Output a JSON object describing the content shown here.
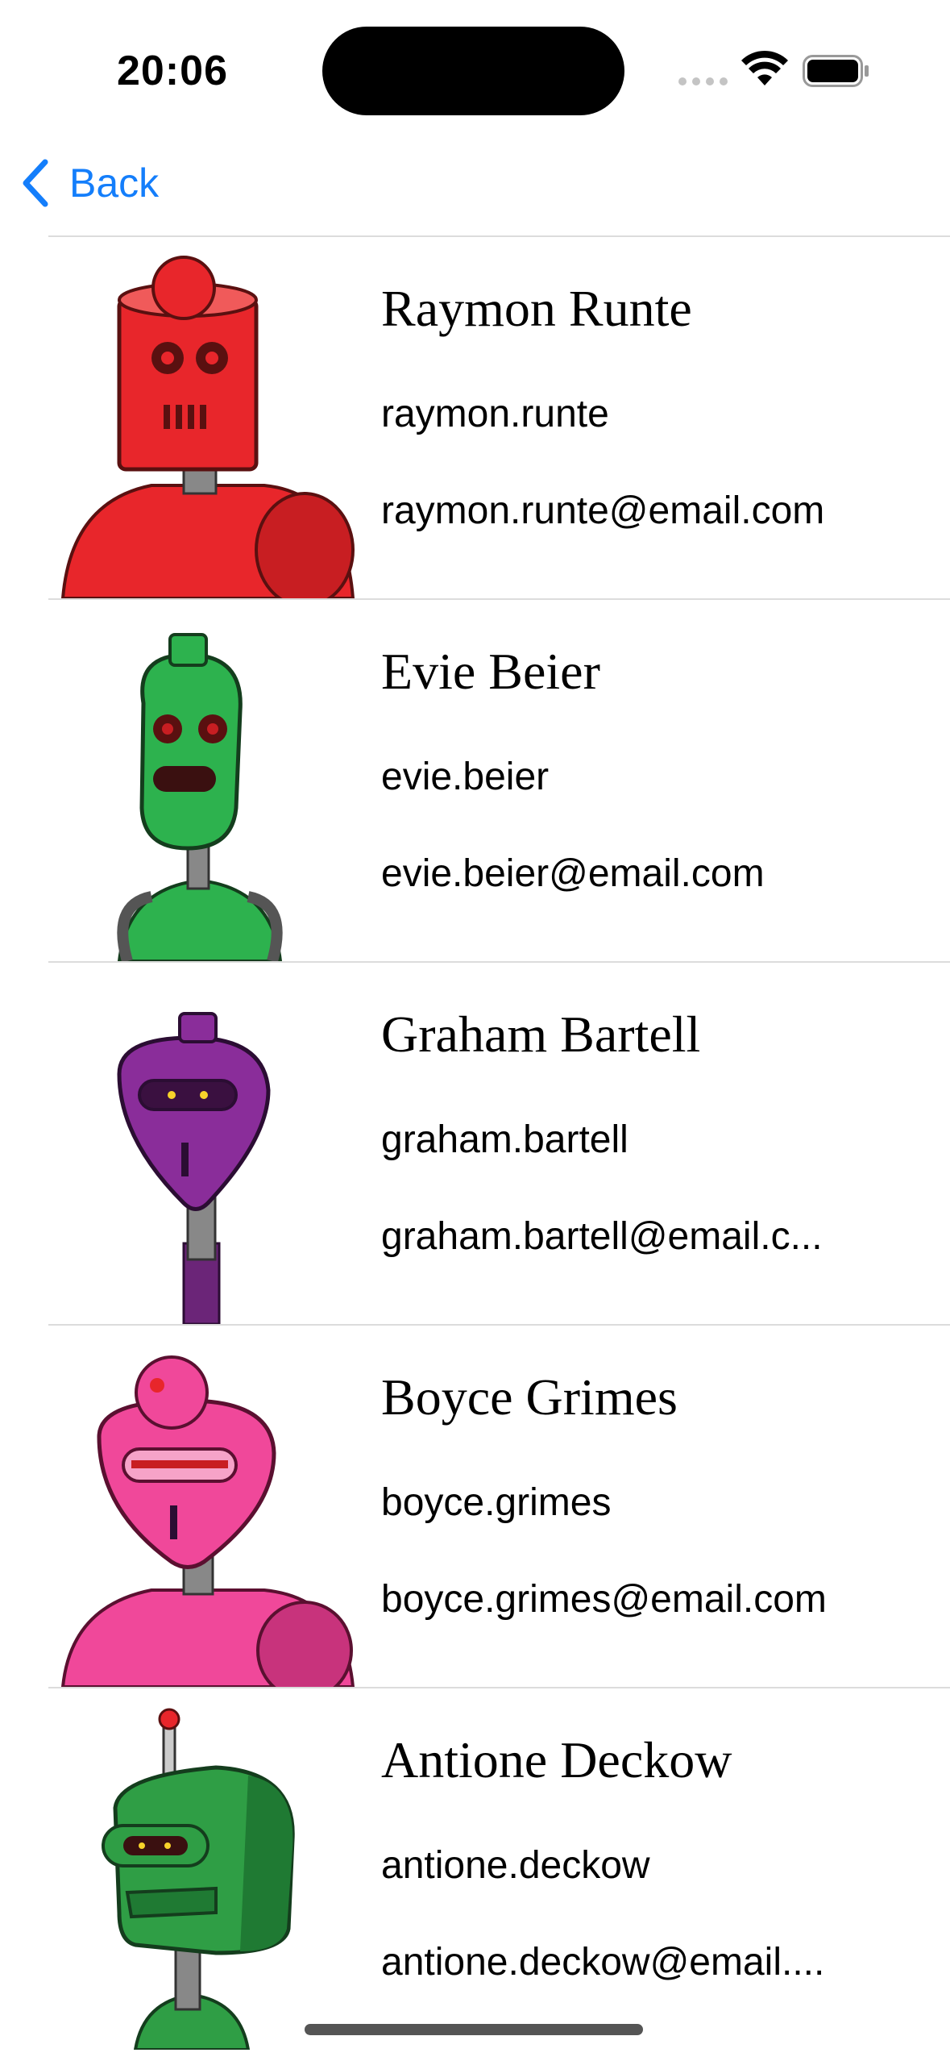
{
  "status_bar": {
    "time": "20:06"
  },
  "nav": {
    "back_label": "Back"
  },
  "accent_color": "#147EFB",
  "contacts": [
    {
      "name": "Raymon Runte",
      "username": "raymon.runte",
      "email": "raymon.runte@email.com",
      "avatar_color": "#E8262B"
    },
    {
      "name": "Evie Beier",
      "username": "evie.beier",
      "email": "evie.beier@email.com",
      "avatar_color": "#2DB24E"
    },
    {
      "name": "Graham Bartell",
      "username": "graham.bartell",
      "email": "graham.bartell@email.c...",
      "avatar_color": "#8A2D9A"
    },
    {
      "name": "Boyce Grimes",
      "username": "boyce.grimes",
      "email": "boyce.grimes@email.com",
      "avatar_color": "#F0489A"
    },
    {
      "name": "Antione Deckow",
      "username": "antione.deckow",
      "email": "antione.deckow@email....",
      "avatar_color": "#2F9E45"
    }
  ]
}
